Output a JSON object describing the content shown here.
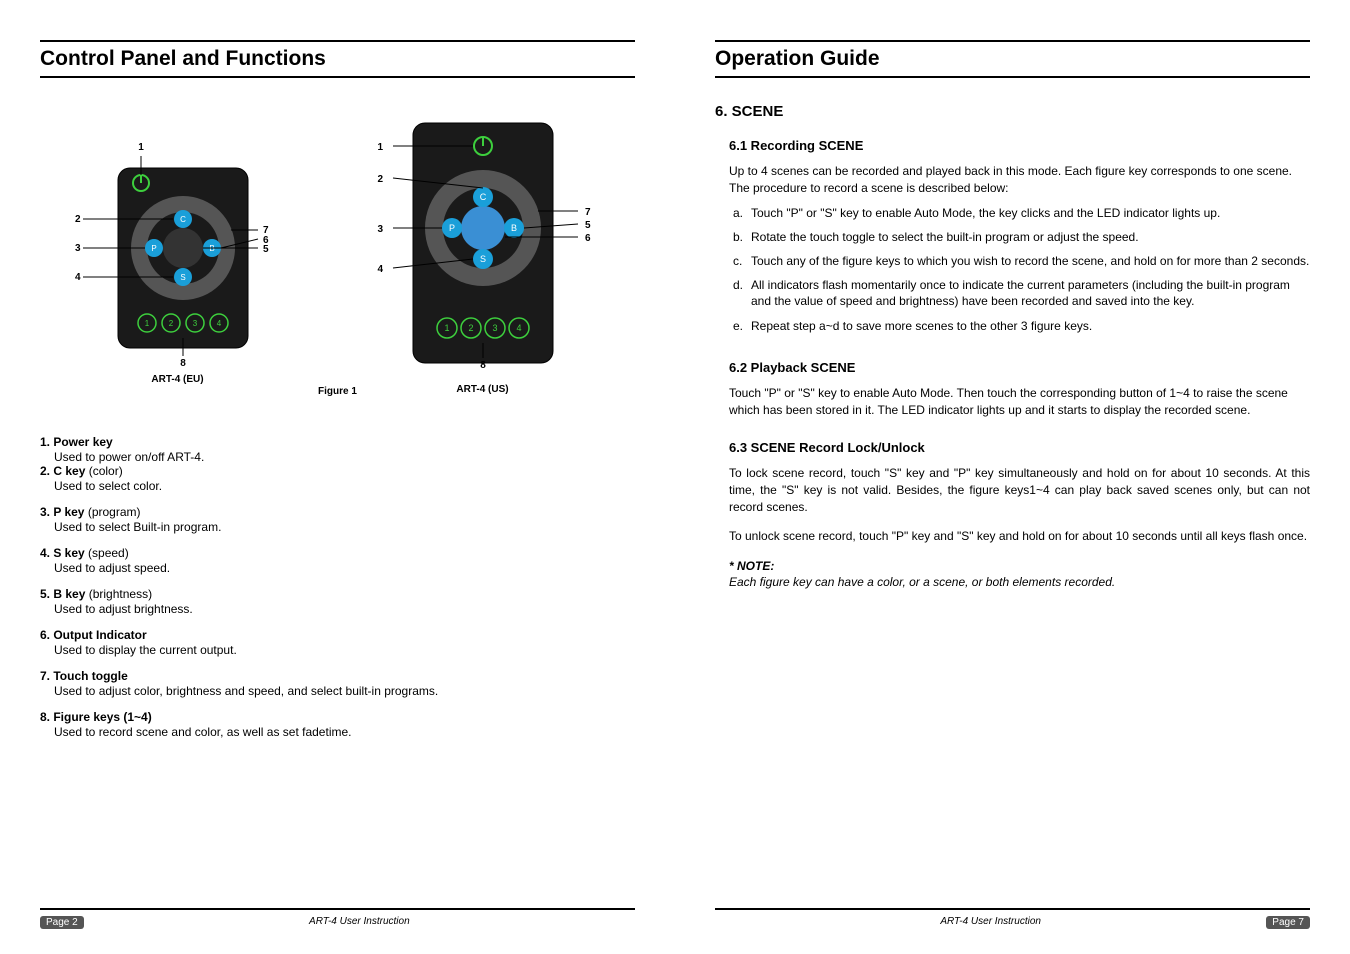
{
  "left": {
    "title": "Control Panel and Functions",
    "figure": {
      "left_label": "ART-4 (EU)",
      "right_label": "ART-4 (US)",
      "caption": "Figure 1",
      "callouts_left": {
        "c1": "1",
        "c2": "2",
        "c3": "3",
        "c4": "4",
        "c5": "5",
        "c6": "6",
        "c7": "7",
        "c8": "8"
      },
      "callouts_right": {
        "c1": "1",
        "c2": "2",
        "c3": "3",
        "c4": "4",
        "c5": "5",
        "c6": "6",
        "c7": "7",
        "c8": "8"
      }
    },
    "definitions": [
      {
        "head": "1. Power key",
        "sub": "",
        "desc": "Used to power on/off  ART-4."
      },
      {
        "head": "2. C key",
        "sub": " (color)",
        "desc": "Used to select color."
      },
      {
        "head": "3. P key",
        "sub": " (program)",
        "desc": "Used to select Built-in program."
      },
      {
        "head": "4. S key",
        "sub": " (speed)",
        "desc": "Used to adjust speed."
      },
      {
        "head": "5. B key",
        "sub": " (brightness)",
        "desc": "Used to adjust brightness."
      },
      {
        "head": "6. Output Indicator",
        "sub": "",
        "desc": "Used to display the current output."
      },
      {
        "head": "7. Touch toggle",
        "sub": "",
        "desc": "Used to adjust color, brightness and speed, and select built-in programs."
      },
      {
        "head": "8. Figure keys (1~4)",
        "sub": "",
        "desc": "Used to record scene and color, as well as set fadetime."
      }
    ],
    "footer": {
      "page": "Page 2",
      "doc": "ART-4 User Instruction"
    }
  },
  "right": {
    "title": "Operation Guide",
    "section_title": "6. SCENE",
    "s61": {
      "title": "6.1 Recording SCENE",
      "intro": "Up to 4 scenes can be recorded and played back in this mode. Each figure key corresponds to one scene. The procedure to record a scene is described below:",
      "steps": {
        "a": "Touch \"P\" or \"S\" key to enable Auto Mode, the key clicks and the LED indicator lights up.",
        "b": "Rotate the touch toggle to select the built-in program or adjust the speed.",
        "c": "Touch any of the figure keys to which you wish to record the scene, and hold on for more than 2 seconds.",
        "d": "All indicators flash momentarily once to indicate the current parameters (including the built-in program and the value of speed and brightness) have been recorded and saved into the key.",
        "e": "Repeat step a~d to save more scenes to the other 3 figure keys."
      }
    },
    "s62": {
      "title": "6.2 Playback SCENE",
      "body": "Touch \"P\" or \"S\" key to enable Auto Mode. Then touch the corresponding button of 1~4 to raise the scene which has been stored in it. The LED indicator lights up and it starts to display the recorded scene."
    },
    "s63": {
      "title": "6.3 SCENE Record Lock/Unlock",
      "p1": "To lock scene record, touch \"S\" key and \"P\" key simultaneously and hold on for about 10 seconds. At this time, the \"S\" key is not valid. Besides, the figure keys1~4 can play back saved scenes only, but can not record scenes.",
      "p2": "To unlock scene record, touch \"P\" key and \"S\" key and hold on for about 10 seconds until all keys flash once."
    },
    "note": {
      "head": "* NOTE:",
      "body": "Each figure key can have a color, or a scene, or both elements recorded."
    },
    "footer": {
      "page": "Page 7",
      "doc": "ART-4 User Instruction"
    }
  }
}
